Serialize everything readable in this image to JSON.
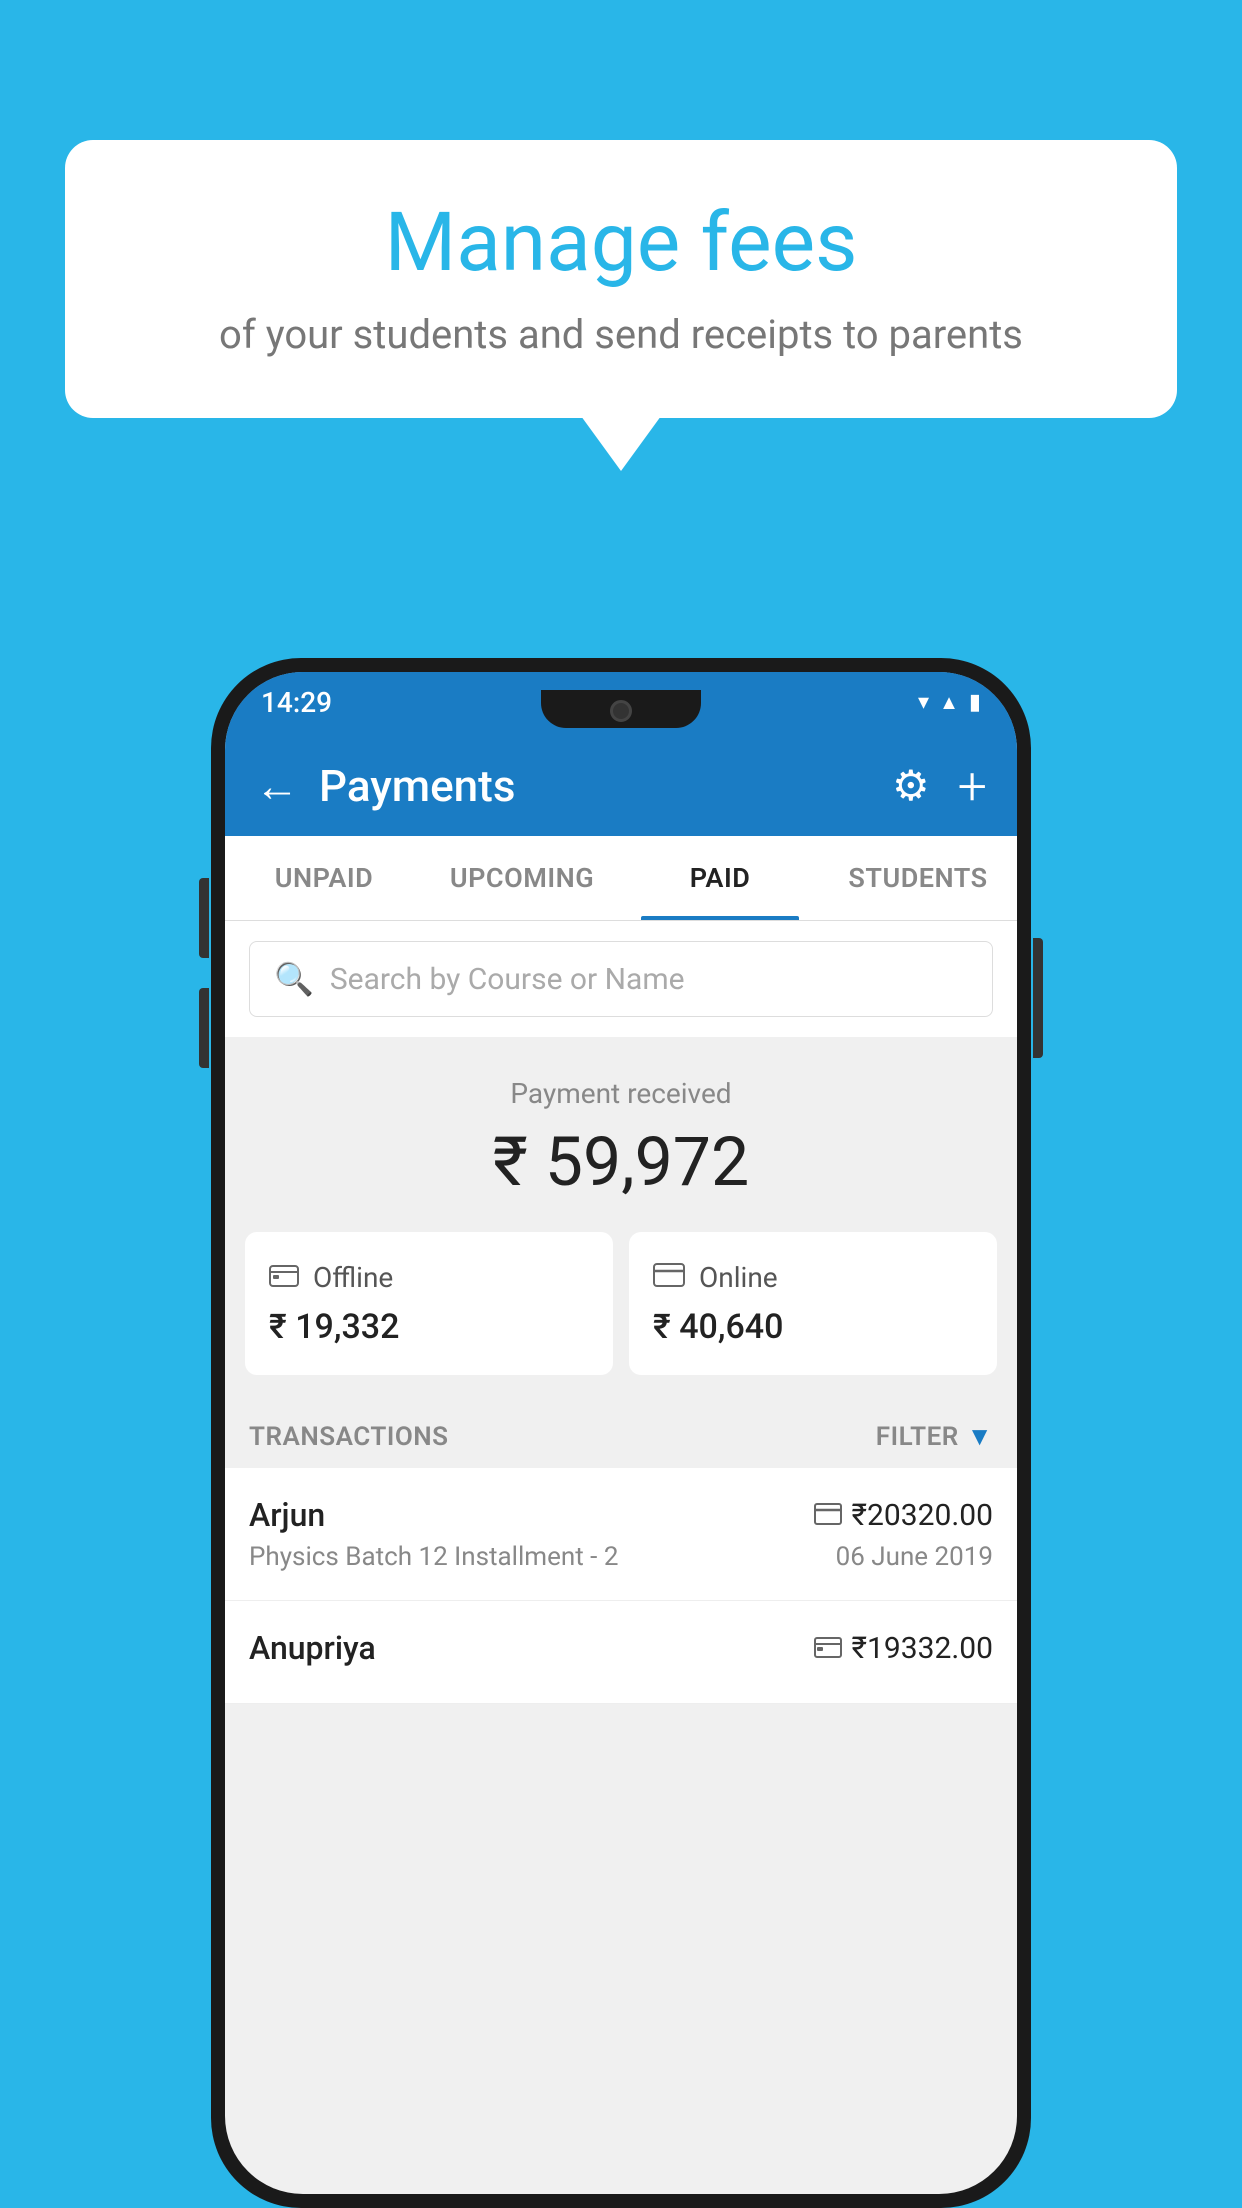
{
  "background_color": "#29B6E8",
  "speech_bubble": {
    "title": "Manage fees",
    "subtitle": "of your students and send receipts to parents"
  },
  "status_bar": {
    "time": "14:29",
    "icons": [
      "wifi",
      "signal",
      "battery"
    ]
  },
  "header": {
    "title": "Payments",
    "back_label": "←",
    "settings_label": "⚙",
    "add_label": "+"
  },
  "tabs": [
    {
      "label": "UNPAID",
      "active": false
    },
    {
      "label": "UPCOMING",
      "active": false
    },
    {
      "label": "PAID",
      "active": true
    },
    {
      "label": "STUDENTS",
      "active": false
    }
  ],
  "search": {
    "placeholder": "Search by Course or Name"
  },
  "payment_received": {
    "label": "Payment received",
    "amount": "₹ 59,972"
  },
  "cards": [
    {
      "icon": "offline",
      "label": "Offline",
      "amount": "₹ 19,332"
    },
    {
      "icon": "online",
      "label": "Online",
      "amount": "₹ 40,640"
    }
  ],
  "transactions_label": "TRANSACTIONS",
  "filter_label": "FILTER",
  "transactions": [
    {
      "name": "Arjun",
      "type_icon": "card",
      "amount": "₹20320.00",
      "course": "Physics Batch 12 Installment - 2",
      "date": "06 June 2019"
    },
    {
      "name": "Anupriya",
      "type_icon": "cash",
      "amount": "₹19332.00",
      "course": "",
      "date": ""
    }
  ]
}
